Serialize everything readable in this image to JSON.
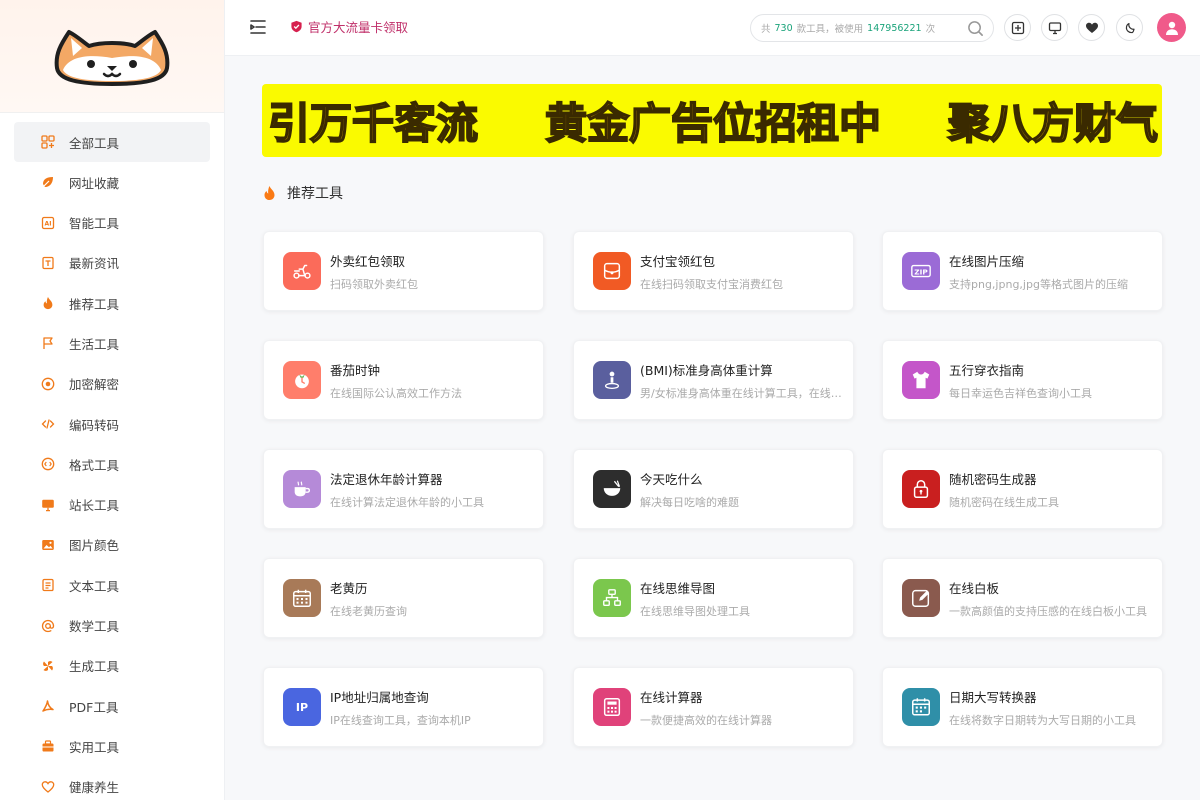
{
  "header": {
    "promo": "官方大流量卡领取",
    "search": {
      "prefix": "共",
      "tools_count": "730",
      "middle": "款工具，被使用",
      "uses_count": "147956221",
      "suffix": "次"
    }
  },
  "sidebar": {
    "items": [
      {
        "label": "全部工具",
        "icon": "grid-icon",
        "active": true
      },
      {
        "label": "网址收藏",
        "icon": "bookmark-icon"
      },
      {
        "label": "智能工具",
        "icon": "ai-icon"
      },
      {
        "label": "最新资讯",
        "icon": "news-icon"
      },
      {
        "label": "推荐工具",
        "icon": "fire-icon"
      },
      {
        "label": "生活工具",
        "icon": "flag-icon"
      },
      {
        "label": "加密解密",
        "icon": "lock-icon"
      },
      {
        "label": "编码转码",
        "icon": "code-icon"
      },
      {
        "label": "格式工具",
        "icon": "format-icon"
      },
      {
        "label": "站长工具",
        "icon": "monitor-icon"
      },
      {
        "label": "图片颜色",
        "icon": "image-icon"
      },
      {
        "label": "文本工具",
        "icon": "text-icon"
      },
      {
        "label": "数学工具",
        "icon": "at-icon"
      },
      {
        "label": "生成工具",
        "icon": "generate-icon"
      },
      {
        "label": "PDF工具",
        "icon": "pdf-icon"
      },
      {
        "label": "实用工具",
        "icon": "toolbox-icon"
      },
      {
        "label": "健康养生",
        "icon": "heart-icon"
      }
    ]
  },
  "banner": {
    "parts": [
      "引万千客流",
      "黄金广告位招租中",
      "聚八方财气"
    ]
  },
  "section": {
    "title": "推荐工具"
  },
  "tools": [
    {
      "title": "外卖红包领取",
      "desc": "扫码领取外卖红包",
      "icon": "scooter-icon",
      "color": "#fb6b5a"
    },
    {
      "title": "支付宝领红包",
      "desc": "在线扫码领取支付宝消费红包",
      "icon": "alipay-envelope-icon",
      "color": "#f15a24"
    },
    {
      "title": "在线图片压缩",
      "desc": "支持png,jpng,jpg等格式图片的压缩",
      "icon": "zip-icon",
      "color": "#9b6bd6"
    },
    {
      "title": "番茄时钟",
      "desc": "在线国际公认高效工作方法",
      "icon": "tomato-icon",
      "color": "#ff7e6b"
    },
    {
      "title": "(BMI)标准身高体重计算",
      "desc": "男/女标准身高体重在线计算工具，在线计算BMI",
      "icon": "person-pin-icon",
      "color": "#5a5f9e"
    },
    {
      "title": "五行穿衣指南",
      "desc": "每日幸运色吉祥色查询小工具",
      "icon": "tshirt-icon",
      "color": "#c456c9"
    },
    {
      "title": "法定退休年龄计算器",
      "desc": "在线计算法定退休年龄的小工具",
      "icon": "coffee-icon",
      "color": "#b58ad8"
    },
    {
      "title": "今天吃什么",
      "desc": "解决每日吃啥的难题",
      "icon": "bowl-icon",
      "color": "#2d2d2d"
    },
    {
      "title": "随机密码生成器",
      "desc": "随机密码在线生成工具",
      "icon": "padlock-icon",
      "color": "#c91f1f"
    },
    {
      "title": "老黄历",
      "desc": "在线老黄历查询",
      "icon": "calendar-icon",
      "color": "#a87a58"
    },
    {
      "title": "在线思维导图",
      "desc": "在线思维导图处理工具",
      "icon": "mindmap-icon",
      "color": "#7bc74d"
    },
    {
      "title": "在线白板",
      "desc": "一款高颜值的支持压感的在线白板小工具",
      "icon": "whiteboard-icon",
      "color": "#8a5a4e"
    },
    {
      "title": "IP地址归属地查询",
      "desc": "IP在线查询工具，查询本机IP",
      "icon": "ip-icon",
      "color": "#4a66e0"
    },
    {
      "title": "在线计算器",
      "desc": "一款便捷高效的在线计算器",
      "icon": "calculator-icon",
      "color": "#e0427a"
    },
    {
      "title": "日期大写转换器",
      "desc": "在线将数字日期转为大写日期的小工具",
      "icon": "date-icon",
      "color": "#2f8fa8"
    }
  ]
}
